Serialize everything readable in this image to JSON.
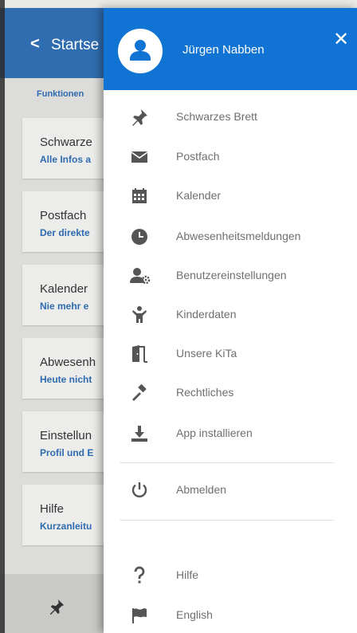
{
  "background_screen": {
    "header_title": "Startse",
    "back_glyph": "<",
    "section_label": "Funktionen",
    "cards": [
      {
        "title": "Schwarze",
        "subtitle": "Alle Infos a"
      },
      {
        "title": "Postfach",
        "subtitle": "Der direkte"
      },
      {
        "title": "Kalender",
        "subtitle": "Nie mehr e"
      },
      {
        "title": "Abwesenh",
        "subtitle": "Heute nicht"
      },
      {
        "title": "Einstellun",
        "subtitle": "Profil und E"
      },
      {
        "title": "Hilfe",
        "subtitle": "Kurzanleitu"
      }
    ]
  },
  "drawer": {
    "user_name": "Jürgen Nabben",
    "close_glyph": "✕",
    "items": [
      {
        "label": "Schwarzes Brett",
        "icon": "pin-icon"
      },
      {
        "label": "Postfach",
        "icon": "mail-icon"
      },
      {
        "label": "Kalender",
        "icon": "calendar-icon"
      },
      {
        "label": "Abwesenheitsmeldungen",
        "icon": "clock-icon"
      },
      {
        "label": "Benutzereinstellungen",
        "icon": "user-settings-icon"
      },
      {
        "label": "Kinderdaten",
        "icon": "child-icon"
      },
      {
        "label": "Unsere KiTa",
        "icon": "door-icon"
      },
      {
        "label": "Rechtliches",
        "icon": "gavel-icon"
      },
      {
        "label": "App installieren",
        "icon": "download-icon"
      }
    ],
    "logout": {
      "label": "Abmelden",
      "icon": "power-icon"
    },
    "footer_items": [
      {
        "label": "Hilfe",
        "icon": "help-icon"
      },
      {
        "label": "English",
        "icon": "flag-icon"
      }
    ]
  },
  "colors": {
    "header_blue": "#1173d4",
    "background_header": "#2f6db0",
    "icon_gray": "#555555",
    "label_gray": "#6f6f6f"
  }
}
